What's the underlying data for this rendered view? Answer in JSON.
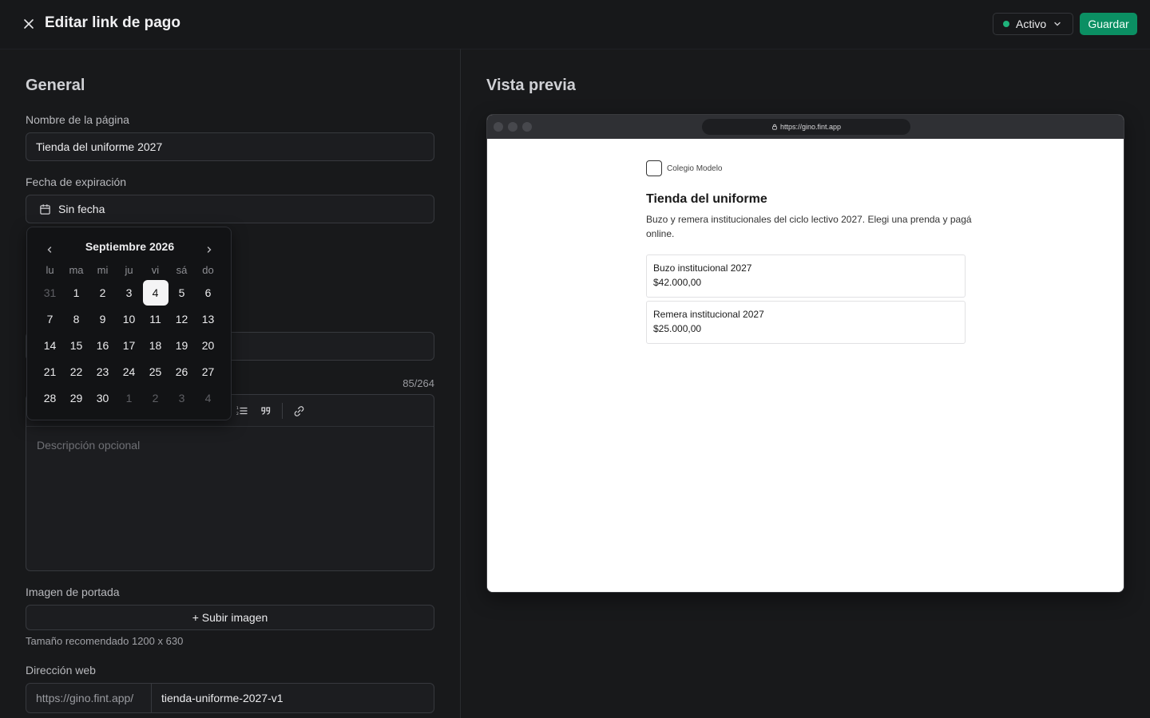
{
  "header": {
    "title": "Editar link de pago",
    "status_label": "Activo",
    "status_color": "#1fb37b",
    "save_label": "Guardar",
    "accent_color": "#0b8f63"
  },
  "form": {
    "section_title": "General",
    "name_label": "Nombre de la página",
    "name_value": "Tienda del uniforme 2027",
    "expiry_label": "Fecha de expiración",
    "expiry_value": "Sin fecha",
    "description_counter": "85/264",
    "description_placeholder": "Descripción opcional",
    "cover_label": "Imagen de portada",
    "upload_label": "+ Subir imagen",
    "cover_hint": "Tamaño recomendado 1200 x 630",
    "web_label": "Dirección web",
    "url_prefix": "https://gino.fint.app/",
    "url_slug": "tienda-uniforme-2027-v1"
  },
  "calendar": {
    "month_label": "Septiembre 2026",
    "weekdays": [
      "lu",
      "ma",
      "mi",
      "ju",
      "vi",
      "sá",
      "do"
    ],
    "days": [
      {
        "d": "31",
        "m": true
      },
      {
        "d": "1"
      },
      {
        "d": "2"
      },
      {
        "d": "3"
      },
      {
        "d": "4",
        "s": true
      },
      {
        "d": "5"
      },
      {
        "d": "6"
      },
      {
        "d": "7"
      },
      {
        "d": "8"
      },
      {
        "d": "9"
      },
      {
        "d": "10"
      },
      {
        "d": "11"
      },
      {
        "d": "12"
      },
      {
        "d": "13"
      },
      {
        "d": "14"
      },
      {
        "d": "15"
      },
      {
        "d": "16"
      },
      {
        "d": "17"
      },
      {
        "d": "18"
      },
      {
        "d": "19"
      },
      {
        "d": "20"
      },
      {
        "d": "21"
      },
      {
        "d": "22"
      },
      {
        "d": "23"
      },
      {
        "d": "24"
      },
      {
        "d": "25"
      },
      {
        "d": "26"
      },
      {
        "d": "27"
      },
      {
        "d": "28"
      },
      {
        "d": "29"
      },
      {
        "d": "30"
      },
      {
        "d": "1",
        "m": true
      },
      {
        "d": "2",
        "m": true
      },
      {
        "d": "3",
        "m": true
      },
      {
        "d": "4",
        "m": true
      }
    ]
  },
  "preview": {
    "title": "Vista previa",
    "url": "https://gino.fint.app",
    "org_name": "Colegio Modelo",
    "store_title": "Tienda del uniforme",
    "store_description": "Buzo y remera institucionales del ciclo lectivo 2027. Elegi una prenda y pagá online.",
    "products": [
      {
        "name": "Buzo institucional 2027",
        "price": "$42.000,00"
      },
      {
        "name": "Remera institucional 2027",
        "price": "$25.000,00"
      }
    ]
  }
}
